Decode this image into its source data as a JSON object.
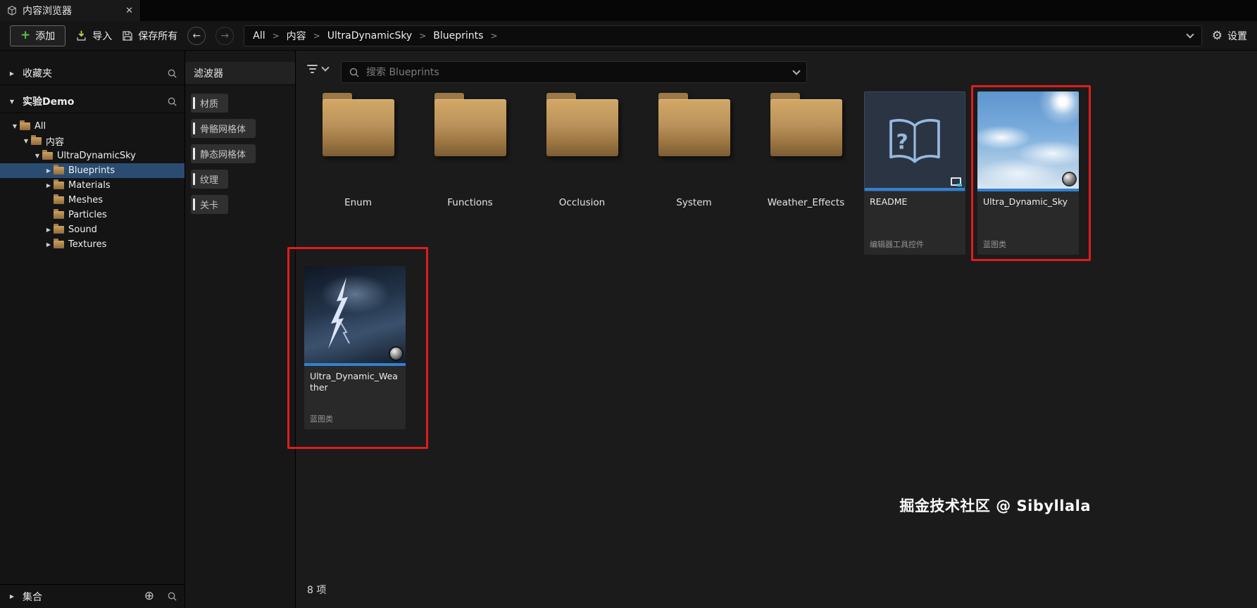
{
  "window": {
    "tab_title": "内容浏览器"
  },
  "icons": {
    "plus": "+",
    "back_arrow": "←",
    "forward_arrow": "→",
    "gear": "⚙",
    "close": "✕",
    "crumb_separator": ">",
    "expander_open": "▼",
    "expander_closed": "▶",
    "circle_plus": "⊕"
  },
  "toolbar": {
    "add_label": "添加",
    "import_label": "导入",
    "save_all_label": "保存所有",
    "breadcrumb": [
      "All",
      "内容",
      "UltraDynamicSky",
      "Blueprints"
    ],
    "settings_label": "设置"
  },
  "sidebar": {
    "favorites_label": "收藏夹",
    "source_label": "实验Demo",
    "tree": [
      {
        "arrow": "▼",
        "label": "All"
      },
      {
        "arrow": "▼",
        "label": "内容"
      },
      {
        "arrow": "▼",
        "label": "UltraDynamicSky"
      },
      {
        "arrow": "▶",
        "label": "Blueprints"
      },
      {
        "arrow": "▶",
        "label": "Materials"
      },
      {
        "arrow": "",
        "label": "Meshes"
      },
      {
        "arrow": "",
        "label": "Particles"
      },
      {
        "arrow": "▶",
        "label": "Sound"
      },
      {
        "arrow": "▶",
        "label": "Textures"
      }
    ],
    "collections_label": "集合"
  },
  "filters": {
    "title": "滤波器",
    "items": [
      "材质",
      "骨骼网格体",
      "静态网格体",
      "纹理",
      "关卡"
    ]
  },
  "content": {
    "search_placeholder": "搜索 Blueprints",
    "folders": [
      "Enum",
      "Functions",
      "Occlusion",
      "System",
      "Weather_Effects"
    ],
    "assets": [
      {
        "name": "README",
        "type": "编辑器工具控件"
      },
      {
        "name": "Ultra_Dynamic_Sky",
        "type": "蓝图类"
      },
      {
        "name": "Ultra_Dynamic_Weather",
        "type": "蓝图类"
      }
    ],
    "item_count": "8 项"
  },
  "watermark": "掘金技术社区 @ Sibyllala",
  "colors": {
    "selection": "#2a4c70",
    "accent_underline": "#3181d2",
    "annotation_red": "#df1d1d",
    "folder_tan": "#c79a58"
  }
}
